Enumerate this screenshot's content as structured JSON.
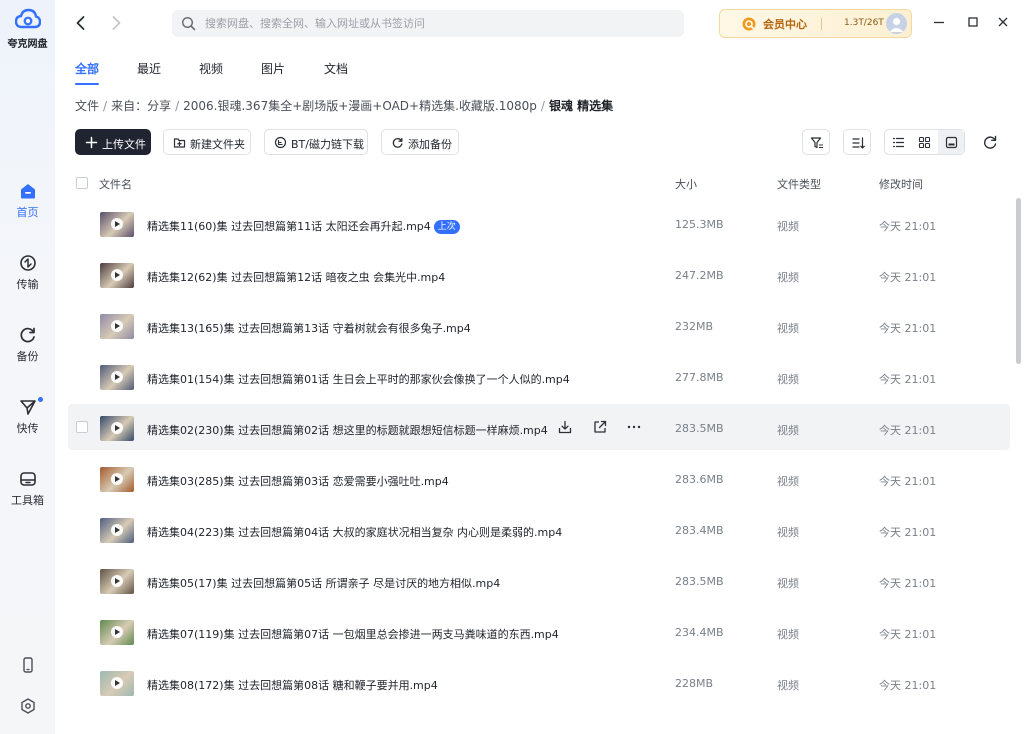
{
  "app": {
    "name": "夸克网盘",
    "brand_color": "#3370ff"
  },
  "sidebar": {
    "items": [
      {
        "label": "首页",
        "icon": "home-icon",
        "active": true
      },
      {
        "label": "传输",
        "icon": "transfer-icon",
        "active": false
      },
      {
        "label": "备份",
        "icon": "backup-icon",
        "active": false
      },
      {
        "label": "快传",
        "icon": "quick-send-icon",
        "active": false,
        "has_dot": true
      },
      {
        "label": "工具箱",
        "icon": "toolbox-icon",
        "active": false
      }
    ],
    "bottom_icons": [
      "phone-icon",
      "settings-icon"
    ]
  },
  "topbar": {
    "search_placeholder": "搜索网盘、搜索全网、输入网址或从书签访问",
    "vip_label": "会员中心",
    "storage": "1.3T/26T"
  },
  "tabs": [
    {
      "label": "全部",
      "active": true
    },
    {
      "label": "最近",
      "active": false
    },
    {
      "label": "视频",
      "active": false
    },
    {
      "label": "图片",
      "active": false
    },
    {
      "label": "文档",
      "active": false
    }
  ],
  "breadcrumb": {
    "items": [
      "文件",
      "来自：分享",
      "2006.银魂.367集全+剧场版+漫画+OAD+精选集.收藏版.1080p"
    ],
    "current": "银魂 精选集"
  },
  "toolbar": {
    "upload": "上传文件",
    "new_folder": "新建文件夹",
    "bt_download": "BT/磁力链下载",
    "add_backup": "添加备份"
  },
  "table": {
    "headers": {
      "name": "文件名",
      "size": "大小",
      "type": "文件类型",
      "modified": "修改时间"
    },
    "rows": [
      {
        "name": "精选集11(60)集 过去回想篇第11话 太阳还会再升起.mp4",
        "badge": "上次",
        "size": "125.3MB",
        "type": "视频",
        "modified": "今天 21:01",
        "thumb_color": "#5a4e6c"
      },
      {
        "name": "精选集12(62)集 过去回想篇第12话 暗夜之虫 会集光中.mp4",
        "size": "247.2MB",
        "type": "视频",
        "modified": "今天 21:01",
        "thumb_color": "#4b3b3f"
      },
      {
        "name": "精选集13(165)集 过去回想篇第13话 守着树就会有很多兔子.mp4",
        "size": "232MB",
        "type": "视频",
        "modified": "今天 21:01",
        "thumb_color": "#8f8aa8"
      },
      {
        "name": "精选集01(154)集 过去回想篇第01话 生日会上平时的那家伙会像换了一个人似的.mp4",
        "size": "277.8MB",
        "type": "视频",
        "modified": "今天 21:01",
        "thumb_color": "#4f5a78"
      },
      {
        "name": "精选集02(230)集 过去回想篇第02话 想这里的标题就跟想短信标题一样麻烦.mp4",
        "size": "283.5MB",
        "type": "视频",
        "modified": "今天 21:01",
        "thumb_color": "#34496a",
        "hover": true
      },
      {
        "name": "精选集03(285)集 过去回想篇第03话 恋爱需要小强吐吐.mp4",
        "size": "283.6MB",
        "type": "视频",
        "modified": "今天 21:01",
        "thumb_color": "#a35a2c"
      },
      {
        "name": "精选集04(223)集 过去回想篇第04话 大叔的家庭状况相当复杂 内心则是柔弱的.mp4",
        "size": "283.4MB",
        "type": "视频",
        "modified": "今天 21:01",
        "thumb_color": "#4c5d80"
      },
      {
        "name": "精选集05(17)集 过去回想篇第05话 所谓亲子 尽是讨厌的地方相似.mp4",
        "size": "283.5MB",
        "type": "视频",
        "modified": "今天 21:01",
        "thumb_color": "#5f5244"
      },
      {
        "name": "精选集07(119)集 过去回想篇第07话 一包烟里总会掺进一两支马粪味道的东西.mp4",
        "size": "234.4MB",
        "type": "视频",
        "modified": "今天 21:01",
        "thumb_color": "#5f8a4e"
      },
      {
        "name": "精选集08(172)集 过去回想篇第08话 糖和鞭子要并用.mp4",
        "size": "228MB",
        "type": "视频",
        "modified": "今天 21:01",
        "thumb_color": "#9db8b0"
      }
    ]
  }
}
